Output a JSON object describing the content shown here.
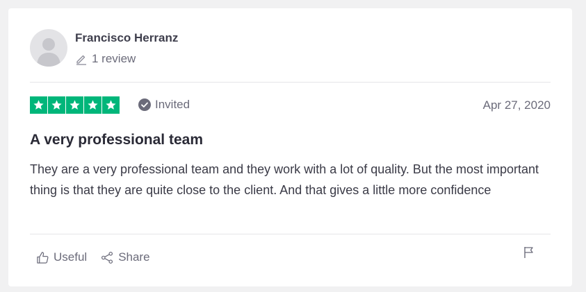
{
  "consumer": {
    "name": "Francisco Herranz",
    "review_count": "1 review"
  },
  "review": {
    "rating": 5,
    "rating_max": 5,
    "status": "Invited",
    "date": "Apr 27, 2020",
    "title": "A very professional team",
    "body": "They are a very professional team and they work with a lot of quality. But the most important thing is that they are quite close to the client. And that gives a little more confidence"
  },
  "actions": {
    "useful_label": "Useful",
    "share_label": "Share"
  },
  "colors": {
    "star_green": "#00b67a",
    "page_bg": "#f1f1f2",
    "card_bg": "#ffffff",
    "muted_text": "#6b6b7a"
  },
  "icons": {
    "avatar": "user-silhouette-icon",
    "review_count": "pencil-icon",
    "invited": "check-circle-icon",
    "useful": "thumbs-up-icon",
    "share": "share-icon",
    "report": "flag-icon"
  }
}
